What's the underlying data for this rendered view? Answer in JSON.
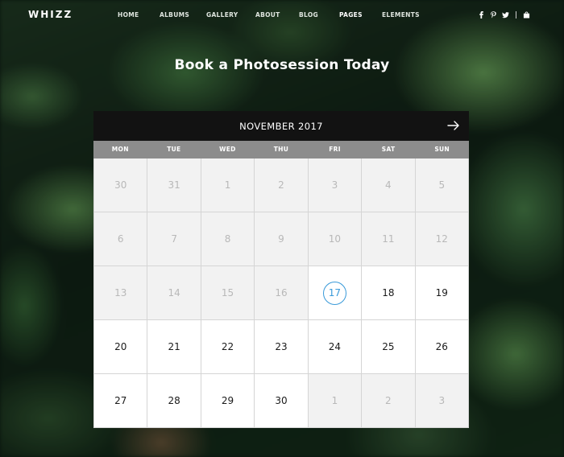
{
  "brand": {
    "logo": "WHIZZ"
  },
  "nav": {
    "items": [
      {
        "label": "HOME"
      },
      {
        "label": "ALBUMS"
      },
      {
        "label": "GALLERY"
      },
      {
        "label": "ABOUT"
      },
      {
        "label": "BLOG"
      },
      {
        "label": "PAGES"
      },
      {
        "label": "ELEMENTS"
      }
    ],
    "active": "PAGES"
  },
  "social": {
    "icons": [
      "facebook-icon",
      "pinterest-icon",
      "twitter-icon",
      "shopping-bag-icon"
    ]
  },
  "hero": {
    "title": "Book a Photosession Today"
  },
  "calendar": {
    "month_title": "NOVEMBER 2017",
    "weekdays": [
      "MON",
      "TUE",
      "WED",
      "THU",
      "FRI",
      "SAT",
      "SUN"
    ],
    "today": "17",
    "accent": "#3a9ad9",
    "days": [
      {
        "n": "30",
        "state": "muted"
      },
      {
        "n": "31",
        "state": "muted"
      },
      {
        "n": "1",
        "state": "muted"
      },
      {
        "n": "2",
        "state": "muted"
      },
      {
        "n": "3",
        "state": "muted"
      },
      {
        "n": "4",
        "state": "muted"
      },
      {
        "n": "5",
        "state": "muted"
      },
      {
        "n": "6",
        "state": "muted"
      },
      {
        "n": "7",
        "state": "muted"
      },
      {
        "n": "8",
        "state": "muted"
      },
      {
        "n": "9",
        "state": "muted"
      },
      {
        "n": "10",
        "state": "muted"
      },
      {
        "n": "11",
        "state": "muted"
      },
      {
        "n": "12",
        "state": "muted"
      },
      {
        "n": "13",
        "state": "muted"
      },
      {
        "n": "14",
        "state": "muted"
      },
      {
        "n": "15",
        "state": "muted"
      },
      {
        "n": "16",
        "state": "muted"
      },
      {
        "n": "17",
        "state": "today"
      },
      {
        "n": "18",
        "state": "available"
      },
      {
        "n": "19",
        "state": "available"
      },
      {
        "n": "20",
        "state": "available"
      },
      {
        "n": "21",
        "state": "available"
      },
      {
        "n": "22",
        "state": "available"
      },
      {
        "n": "23",
        "state": "available"
      },
      {
        "n": "24",
        "state": "available"
      },
      {
        "n": "25",
        "state": "available"
      },
      {
        "n": "26",
        "state": "available"
      },
      {
        "n": "27",
        "state": "available"
      },
      {
        "n": "28",
        "state": "available"
      },
      {
        "n": "29",
        "state": "available"
      },
      {
        "n": "30",
        "state": "available"
      },
      {
        "n": "1",
        "state": "muted"
      },
      {
        "n": "2",
        "state": "muted"
      },
      {
        "n": "3",
        "state": "muted"
      }
    ]
  }
}
